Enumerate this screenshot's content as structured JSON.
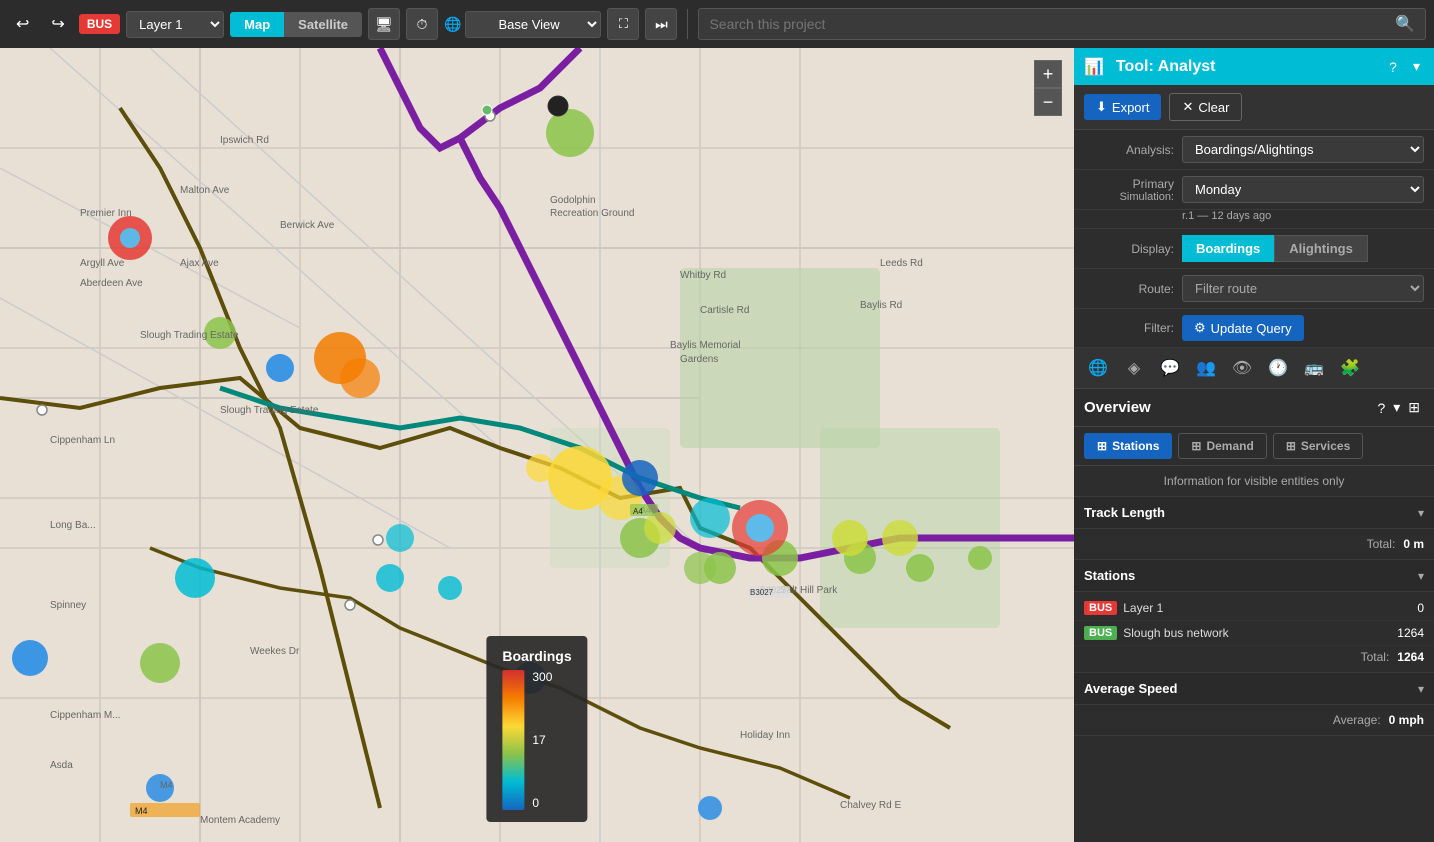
{
  "toolbar": {
    "undo_label": "↩",
    "redo_label": "↪",
    "layer_badge": "BUS",
    "layer_name": "Layer 1",
    "map_btn": "Map",
    "satellite_btn": "Satellite",
    "base_view_label": "Base View",
    "search_placeholder": "Search this project"
  },
  "map_controls": {
    "zoom_in": "+",
    "zoom_out": "−"
  },
  "legend": {
    "title": "Boardings",
    "values": [
      "300",
      "17",
      "0"
    ]
  },
  "panel": {
    "analyst_title": "Tool: Analyst",
    "export_label": "Export",
    "clear_label": "Clear",
    "analysis_label": "Analysis:",
    "analysis_value": "Boardings/Alightings",
    "primary_label": "Primary",
    "simulation_label": "Simulation:",
    "simulation_value": "Monday",
    "simulation_sub": "r.1 — 12 days ago",
    "display_label": "Display:",
    "display_boardings": "Boardings",
    "display_alightings": "Alightings",
    "route_label": "Route:",
    "route_placeholder": "Filter route",
    "filter_label": "Filter:",
    "update_query_label": "Update Query",
    "overview_title": "Overview",
    "tab_stations": "Stations",
    "tab_demand": "Demand",
    "tab_services": "Services",
    "info_text": "Information for visible entities only",
    "track_length_title": "Track Length",
    "track_total_label": "Total:",
    "track_total_value": "0 m",
    "stations_title": "Stations",
    "layer1_badge": "BUS",
    "layer1_name": "Layer 1",
    "layer1_count": "0",
    "slough_badge": "BUS",
    "slough_name": "Slough bus network",
    "slough_count": "1264",
    "stations_total_label": "Total:",
    "stations_total_value": "1264",
    "avg_speed_title": "Average Speed",
    "avg_speed_label": "Average:",
    "avg_speed_value": "0 mph"
  }
}
